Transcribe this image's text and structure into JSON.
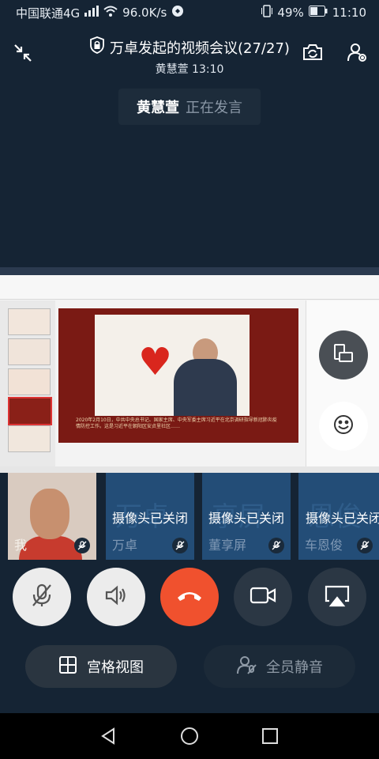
{
  "status_bar": {
    "carrier": "中国联通4G",
    "speed": "96.0K/s",
    "battery": "49%",
    "time": "11:10"
  },
  "header": {
    "title": "万卓发起的视频会议(27/27)",
    "subtitle": "黄慧萱 13:10"
  },
  "speaking": {
    "name": "黄慧萱",
    "state": "正在发言"
  },
  "share_slide": {
    "caption": "2020年2月10日，中共中央总书记、国家主席、中央军委主席习近平在北京调研指导新冠肺炎疫情防控工作。这是习近平在朝阳区安贞里社区……"
  },
  "participants": [
    {
      "name": "我",
      "camera": ""
    },
    {
      "name": "万卓",
      "camera": "摄像头已关闭",
      "ghost": "万卓"
    },
    {
      "name": "董享屏",
      "camera": "摄像头已关闭",
      "ghost": "享屏"
    },
    {
      "name": "车恩俊",
      "camera": "摄像头已关闭",
      "ghost": "恩俊"
    }
  ],
  "bottom": {
    "grid_view": "宫格视图",
    "mute_all": "全员静音"
  },
  "colors": {
    "background": "#152434",
    "hangup": "#f0512e",
    "tile": "#234d77"
  }
}
